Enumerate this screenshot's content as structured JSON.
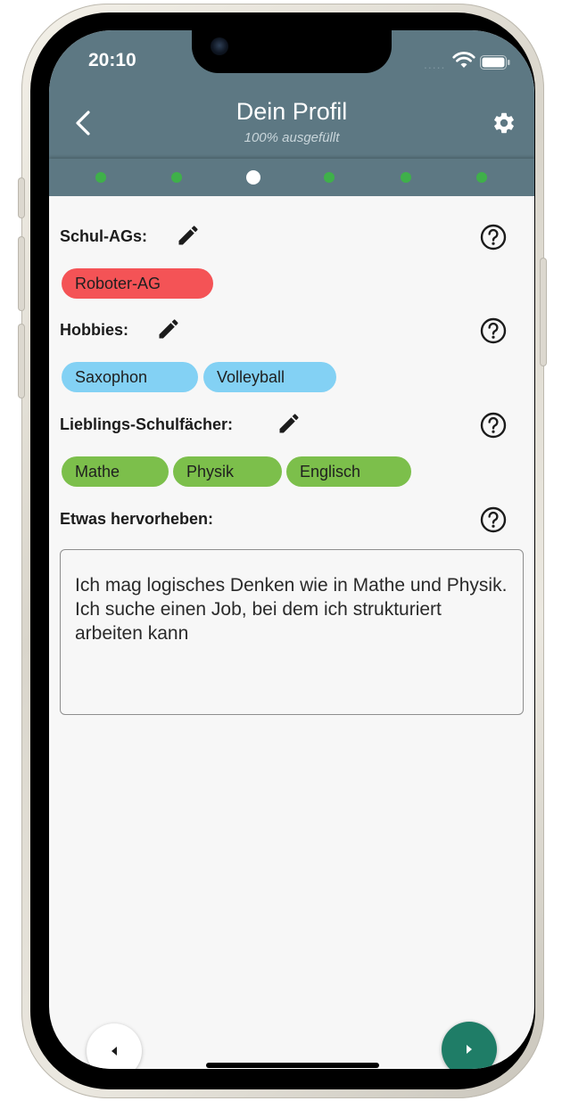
{
  "status_bar": {
    "time": "20:10",
    "signal": "....."
  },
  "header": {
    "title": "Dein Profil",
    "subtitle": "100% ausgefüllt"
  },
  "progress": {
    "steps": 6,
    "current_step": 3
  },
  "sections": {
    "schul_ags": {
      "label": "Schul-AGs:",
      "chips": [
        "Roboter-AG"
      ]
    },
    "hobbies": {
      "label": "Hobbies:",
      "chips": [
        "Saxophon",
        "Volleyball"
      ]
    },
    "faecher": {
      "label": "Lieblings-Schulfächer:",
      "chips": [
        "Mathe",
        "Physik",
        "Englisch"
      ]
    },
    "highlight": {
      "label": "Etwas hervorheben:",
      "text": "Ich mag logisches Denken wie in Mathe und Physik. Ich suche einen Job, bei dem ich strukturiert arbeiten kann"
    }
  },
  "colors": {
    "header": "#5d7883",
    "step_done": "#3fb04a",
    "chip_ag": "#f45356",
    "chip_hobby": "#83d1f4",
    "chip_subject": "#7cbf4b",
    "next_button": "#1f7d67"
  },
  "icons": {
    "back": "chevron-left-icon",
    "settings": "gear-icon",
    "edit": "pencil-icon",
    "help": "question-circle-icon",
    "prev": "triangle-left-icon",
    "next": "triangle-right-icon"
  }
}
